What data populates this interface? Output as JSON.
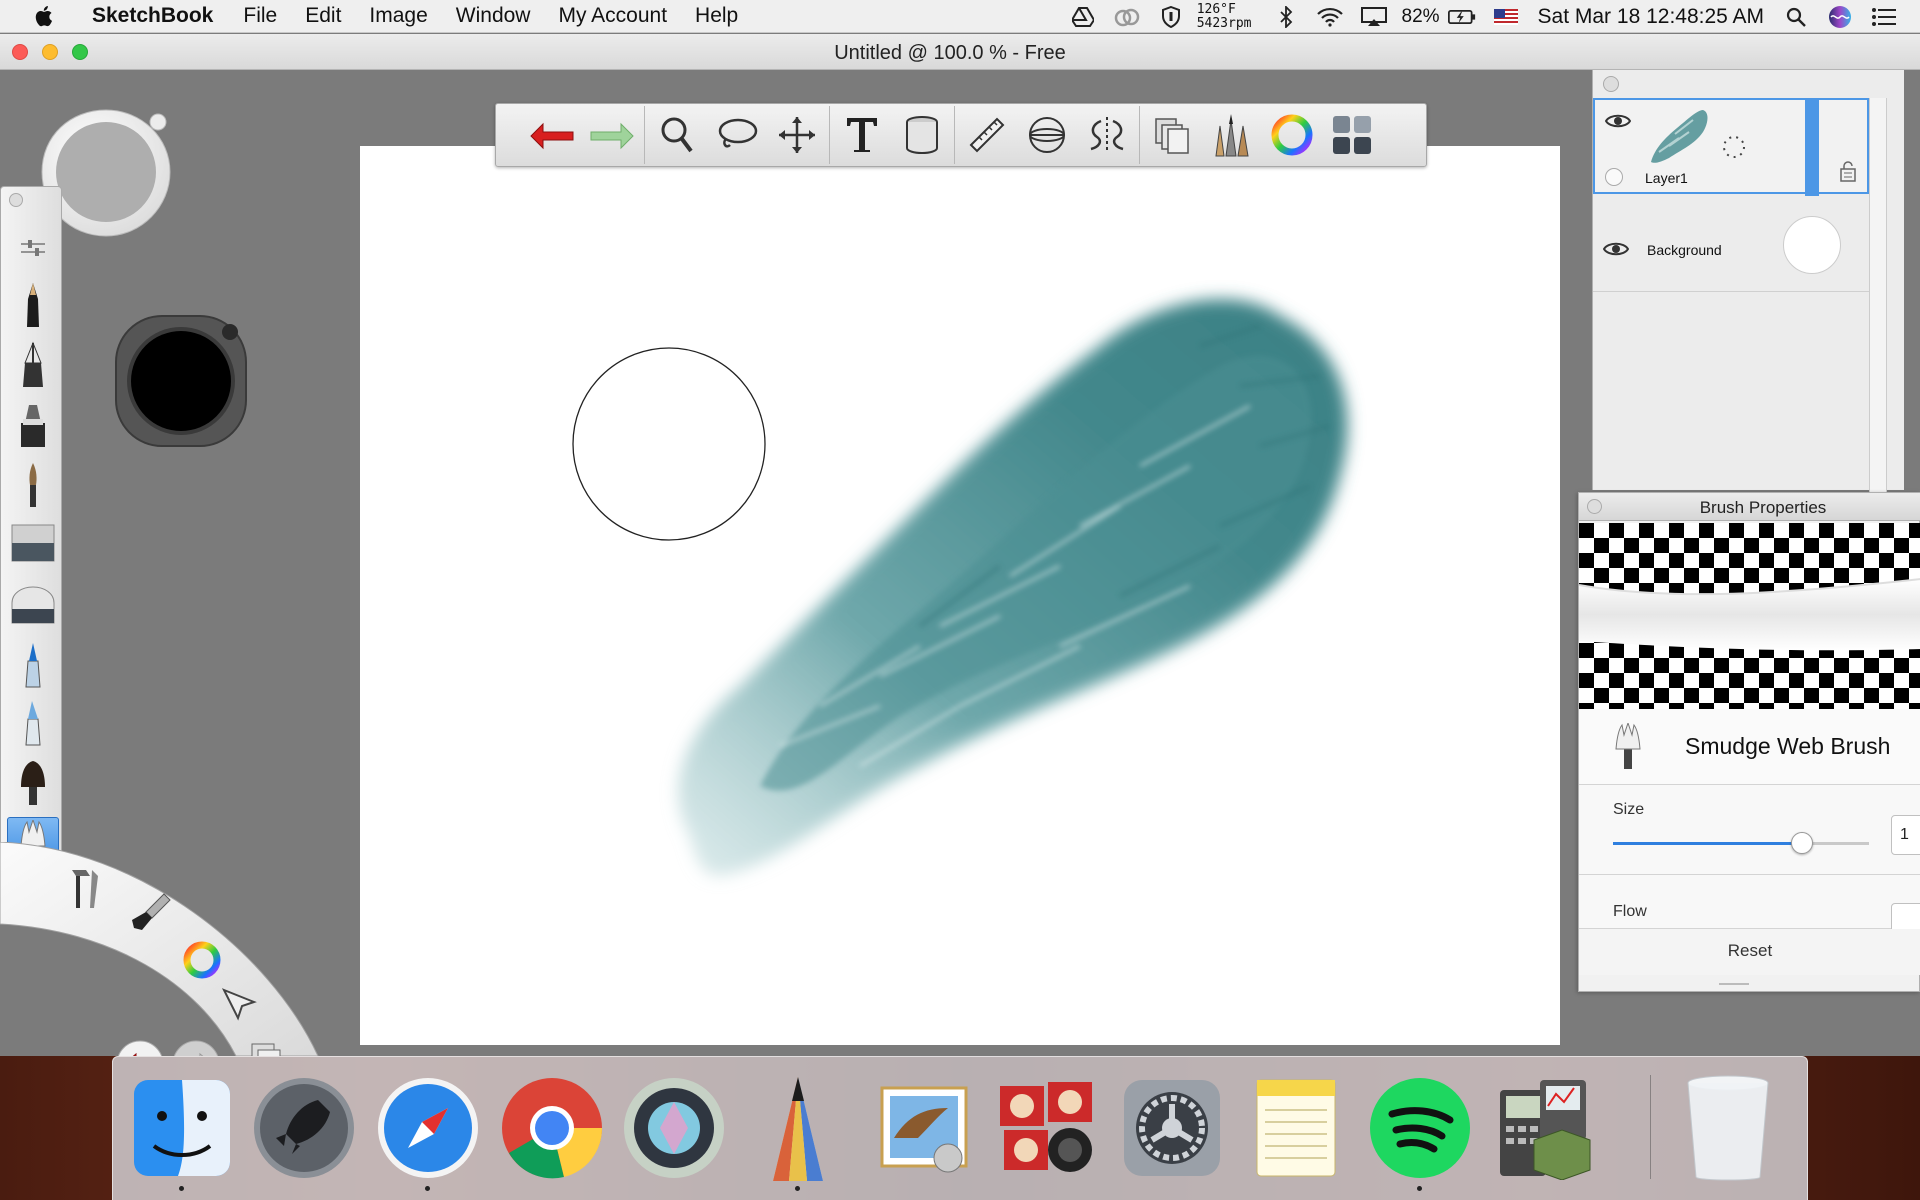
{
  "menubar": {
    "app_name": "SketchBook",
    "items": [
      "File",
      "Edit",
      "Image",
      "Window",
      "My Account",
      "Help"
    ],
    "temp_line1": "126°F",
    "temp_line2": "5423rpm",
    "battery": "82%",
    "clock": "Sat Mar 18  12:48:25 AM"
  },
  "window": {
    "title": "Untitled @ 100.0 % - Free"
  },
  "layers": {
    "items": [
      {
        "name": "Layer1",
        "active": true
      },
      {
        "name": "Background",
        "active": false
      }
    ]
  },
  "brush_props": {
    "title": "Brush Properties",
    "brush_name": "Smudge Web Brush",
    "size_label": "Size",
    "size_value": "1",
    "size_fraction": 0.74,
    "flow_label": "Flow",
    "reset_label": "Reset"
  },
  "colors": {
    "stroke": "#3f8a8e",
    "accent": "#3a8ae0"
  },
  "icons": {
    "toolbar": [
      "undo-icon",
      "redo-icon",
      "zoom-icon",
      "lasso-icon",
      "move-icon",
      "text-icon",
      "fill-icon",
      "ruler-icon",
      "ellipse-guide-icon",
      "symmetry-icon",
      "copy-layers-icon",
      "brush-library-icon",
      "color-wheel-icon",
      "grid-icon"
    ],
    "dock": [
      "finder-icon",
      "launchpad-icon",
      "safari-icon",
      "chrome-icon",
      "camera-app-icon",
      "sketchbook-pencil-icon",
      "mail-icon",
      "photo-booth-icon",
      "system-preferences-icon",
      "notes-icon",
      "spotify-icon",
      "calculator-icon",
      "trash-icon"
    ]
  }
}
